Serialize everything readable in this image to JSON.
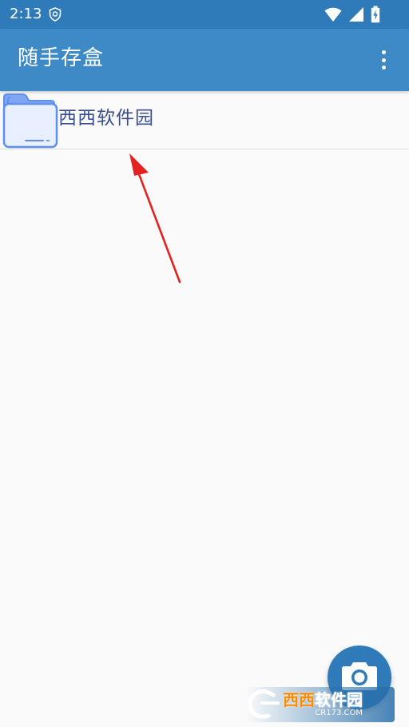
{
  "status_bar": {
    "time": "2:13",
    "icons": [
      "shield-icon",
      "wifi-icon",
      "signal-icon",
      "battery-charging-icon"
    ]
  },
  "app_bar": {
    "title": "随手存盒",
    "menu_icon": "more-vert-icon"
  },
  "folders": [
    {
      "name": "西西软件园",
      "icon": "folder-icon"
    }
  ],
  "fab": {
    "icon": "camera-icon"
  },
  "watermark": {
    "name_accent": "西西",
    "name_rest": "软件园",
    "url": "CR173.COM"
  },
  "colors": {
    "status_bar": "#2f7ab8",
    "app_bar": "#3d8ac7",
    "background": "#fafafa",
    "folder_name": "#3a4f8f",
    "folder_icon_fill": "#e8efff",
    "folder_icon_stroke": "#5e8ff0",
    "fab": "#2f7ab8",
    "annotation_arrow": "#e52222"
  }
}
